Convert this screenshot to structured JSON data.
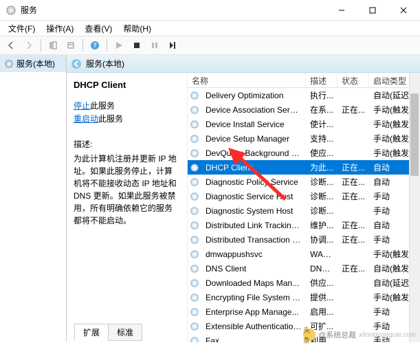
{
  "window": {
    "title": "服务"
  },
  "menu": {
    "file": "文件(F)",
    "action": "操作(A)",
    "view": "查看(V)",
    "help": "帮助(H)"
  },
  "nav": {
    "root": "服务(本地)"
  },
  "detail": {
    "header": "服务(本地)",
    "service_title": "DHCP Client",
    "stop_link": "停止",
    "stop_suffix": "此服务",
    "restart_link": "重启动",
    "restart_suffix": "此服务",
    "desc_label": "描述:",
    "desc_text": "为此计算机注册并更新 IP 地址。如果此服务停止，计算机将不能接收动态 IP 地址和 DNS 更新。如果此服务被禁用，所有明确依赖它的服务都将不能启动。"
  },
  "columns": {
    "name": "名称",
    "desc": "描述",
    "status": "状态",
    "startup": "启动类型"
  },
  "services": [
    {
      "name": "Delivery Optimization",
      "desc": "执行...",
      "status": "",
      "startup": "自动(延迟..."
    },
    {
      "name": "Device Association Service",
      "desc": "在系...",
      "status": "正在...",
      "startup": "手动(触发..."
    },
    {
      "name": "Device Install Service",
      "desc": "使计...",
      "status": "",
      "startup": "手动(触发..."
    },
    {
      "name": "Device Setup Manager",
      "desc": "支持...",
      "status": "",
      "startup": "手动(触发..."
    },
    {
      "name": "DevQuery Background D...",
      "desc": "使应...",
      "status": "",
      "startup": "手动(触发..."
    },
    {
      "name": "DHCP Client",
      "desc": "为此...",
      "status": "正在...",
      "startup": "自动",
      "selected": true
    },
    {
      "name": "Diagnostic Policy Service",
      "desc": "诊断...",
      "status": "正在...",
      "startup": "自动"
    },
    {
      "name": "Diagnostic Service Host",
      "desc": "诊断...",
      "status": "正在...",
      "startup": "手动"
    },
    {
      "name": "Diagnostic System Host",
      "desc": "诊断...",
      "status": "",
      "startup": "手动"
    },
    {
      "name": "Distributed Link Tracking...",
      "desc": "维护...",
      "status": "正在...",
      "startup": "自动"
    },
    {
      "name": "Distributed Transaction C...",
      "desc": "协调...",
      "status": "正在...",
      "startup": "手动"
    },
    {
      "name": "dmwappushsvc",
      "desc": "WAP...",
      "status": "",
      "startup": "手动(触发..."
    },
    {
      "name": "DNS Client",
      "desc": "DNS...",
      "status": "正在...",
      "startup": "自动(触发..."
    },
    {
      "name": "Downloaded Maps Man...",
      "desc": "供应...",
      "status": "",
      "startup": "自动(延迟..."
    },
    {
      "name": "Encrypting File System (E...",
      "desc": "提供...",
      "status": "",
      "startup": "手动(触发..."
    },
    {
      "name": "Enterprise App Manage...",
      "desc": "启用...",
      "status": "",
      "startup": "手动"
    },
    {
      "name": "Extensible Authentication...",
      "desc": "可扩...",
      "status": "",
      "startup": "手动"
    },
    {
      "name": "Fax",
      "desc": "利用...",
      "status": "",
      "startup": "手动"
    }
  ],
  "tabs": {
    "extended": "扩展",
    "standard": "标准"
  },
  "watermark": {
    "logo_text": "头条",
    "text": "@系统总裁",
    "url": "xitongzongcai.com"
  }
}
